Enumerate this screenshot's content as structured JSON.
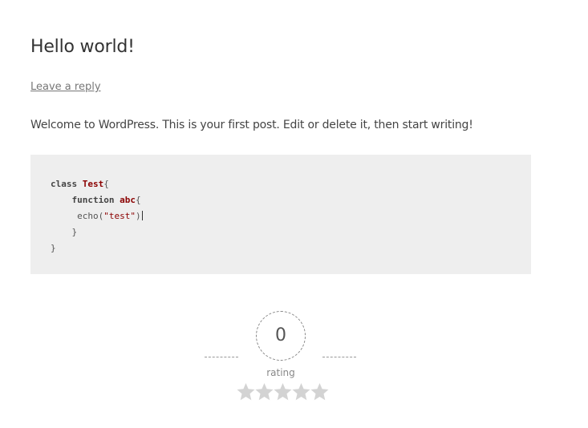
{
  "post": {
    "title": "Hello world!",
    "reply_link": "Leave a reply",
    "body": "Welcome to WordPress. This is your first post. Edit or delete it, then start writing!"
  },
  "code": {
    "line1": {
      "keyword": "class",
      "name": "Test",
      "tail": "{"
    },
    "line2": {
      "keyword": "function",
      "name": "abc",
      "tail": "{"
    },
    "line3": {
      "call": "echo(",
      "string": "\"test\"",
      "tail": ")"
    },
    "line4": {
      "text": "}"
    },
    "line5": {
      "text": "}"
    }
  },
  "rating": {
    "value": "0",
    "label": "rating",
    "stars_total": 5,
    "stars_filled": 0,
    "star_color": "#d3d3d3"
  }
}
